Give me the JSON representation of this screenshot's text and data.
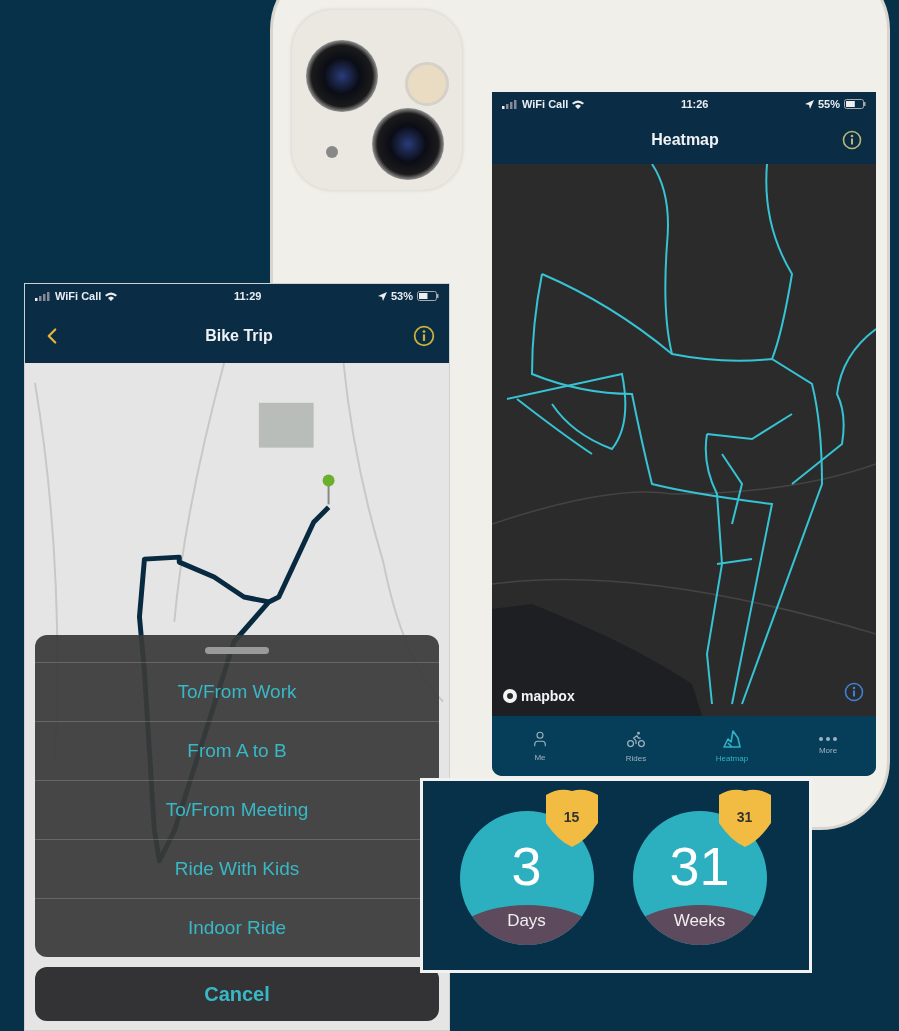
{
  "heatmap_screen": {
    "status_bar": {
      "carrier": "WiFi Call",
      "time": "11:26",
      "battery": "55%"
    },
    "title": "Heatmap",
    "map": {
      "attribution": "mapbox"
    },
    "tabs": [
      {
        "label": "Me",
        "kind": "person",
        "selected": false
      },
      {
        "label": "Rides",
        "kind": "bike",
        "selected": false
      },
      {
        "label": "Heatmap",
        "kind": "heatmap",
        "selected": true
      },
      {
        "label": "More",
        "kind": "more",
        "selected": false
      }
    ]
  },
  "bike_trip_screen": {
    "status_bar": {
      "carrier": "WiFi Call",
      "time": "11:29",
      "battery": "53%"
    },
    "title": "Bike Trip",
    "action_sheet": {
      "options": [
        "To/From Work",
        "From A to B",
        "To/From Meeting",
        "Ride With Kids",
        "Indoor Ride"
      ],
      "cancel": "Cancel"
    }
  },
  "streaks": [
    {
      "value": "3",
      "unit": "Days",
      "badge": "15"
    },
    {
      "value": "31",
      "unit": "Weeks",
      "badge": "31"
    }
  ]
}
